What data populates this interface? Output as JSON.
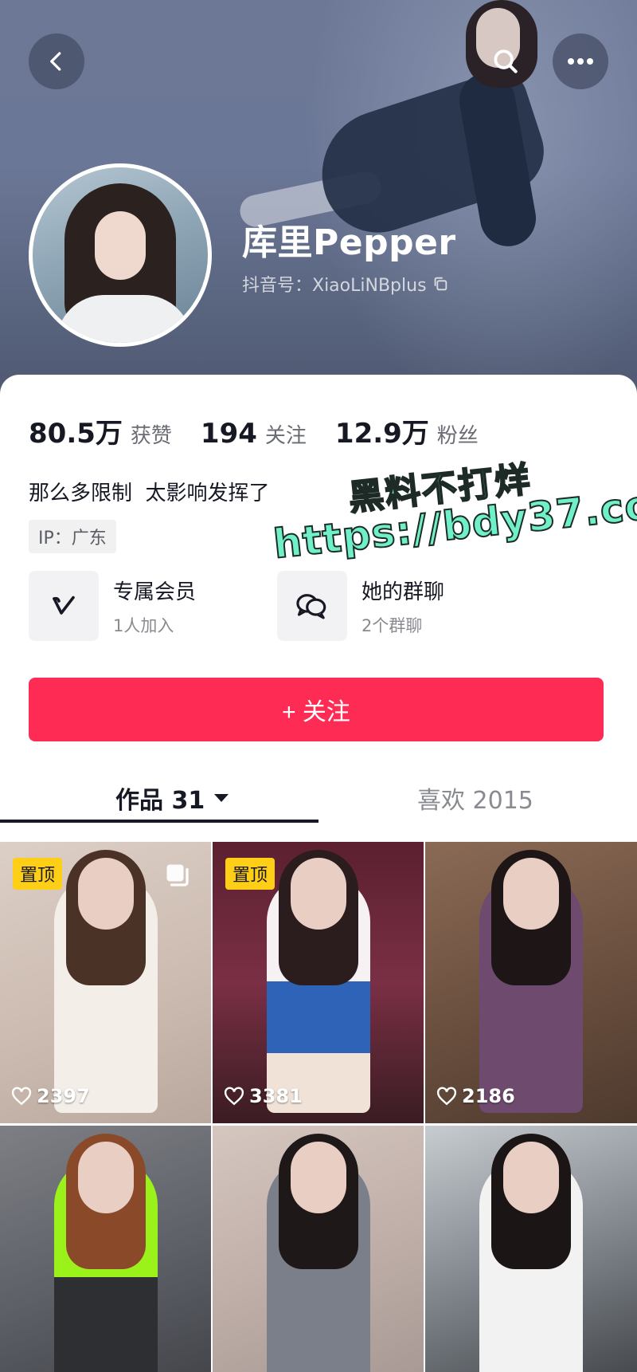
{
  "profile": {
    "name": "库里Pepper",
    "douyin_id": "抖音号：XiaoLiNBplus",
    "bio": "那么多限制  太影响发挥了",
    "ip": "IP：广东"
  },
  "stats": [
    {
      "num": "80.5万",
      "label": "获赞"
    },
    {
      "num": "194",
      "label": "关注"
    },
    {
      "num": "12.9万",
      "label": "粉丝"
    }
  ],
  "features": [
    {
      "title": "专属会员",
      "sub": "1人加入",
      "icon": "v-badge-icon"
    },
    {
      "title": "她的群聊",
      "sub": "2个群聊",
      "icon": "chat-bubbles-icon"
    }
  ],
  "follow_button": "+ 关注",
  "tabs": {
    "works": "作品 31",
    "likes": "喜欢 2015"
  },
  "grid": [
    {
      "likes": "2397",
      "pinned": true,
      "pin_label": "置顶",
      "multi": true
    },
    {
      "likes": "3381",
      "pinned": true,
      "pin_label": "置顶",
      "multi": false
    },
    {
      "likes": "2186",
      "pinned": false,
      "multi": false
    },
    {
      "likes": "",
      "pinned": false,
      "multi": false
    },
    {
      "likes": "",
      "pinned": false,
      "multi": false
    },
    {
      "likes": "",
      "pinned": false,
      "multi": false
    }
  ],
  "watermark": {
    "line1": "黑料不打烊",
    "line2": "https://bdy37.co"
  },
  "colors": {
    "accent": "#fe2c55",
    "pin_badge": "#ffcf18",
    "watermark": "#6ff0c8"
  }
}
